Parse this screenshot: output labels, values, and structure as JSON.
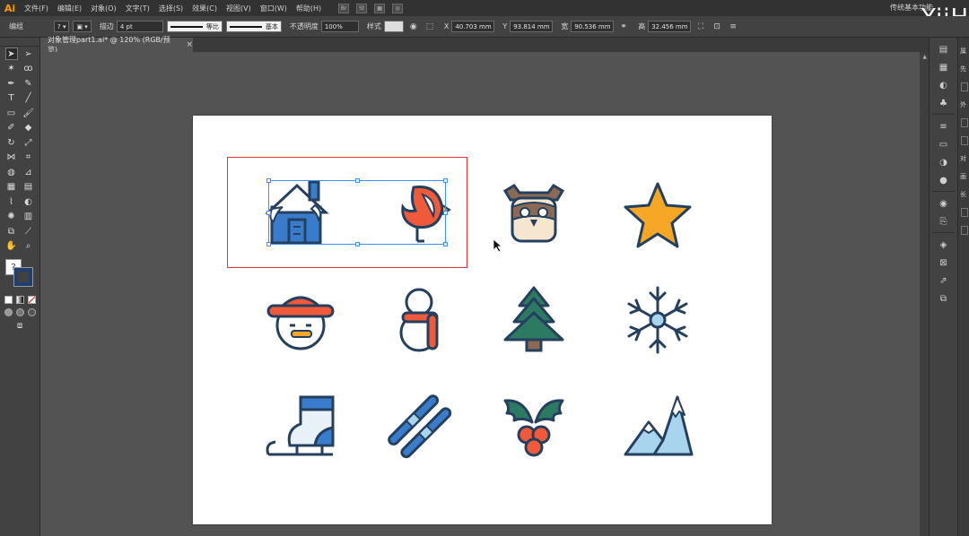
{
  "app": {
    "logo": "Ai",
    "workspace": "传统基本功能",
    "watermark": "YiiH"
  },
  "menu": [
    "文件(F)",
    "编辑(E)",
    "对象(O)",
    "文字(T)",
    "选择(S)",
    "效果(C)",
    "视图(V)",
    "窗口(W)",
    "帮助(H)"
  ],
  "menu_icons": {
    "bridge": "Br",
    "stock": "St"
  },
  "controlbar": {
    "group_label": "编组",
    "stroke_label": "描边",
    "stroke_weight": "4 pt",
    "stroke_profile": "等比",
    "brush_style": "基本",
    "opacity_label": "不透明度",
    "opacity_value": "100%",
    "style_label": "样式",
    "x_label": "X",
    "x_value": "40.703 mm",
    "y_label": "Y",
    "y_value": "93.814 mm",
    "w_label": "宽",
    "w_value": "90.536 mm",
    "h_label": "高",
    "h_value": "32.456 mm"
  },
  "document": {
    "tab_title": "对象管理part1.ai* @ 120% (RGB/预览)",
    "close": "×"
  },
  "toolbar": {
    "fill_glyph": "?"
  },
  "right_panel_b": {
    "labels": [
      "属",
      "先",
      "外",
      "对",
      "画",
      "长"
    ]
  },
  "icons": [
    "house-icon",
    "bird-icon",
    "owl-icon",
    "star-icon",
    "snowman-hat-icon",
    "snowman-scarf-icon",
    "pine-tree-icon",
    "snowflake-icon",
    "ice-skate-icon",
    "skis-icon",
    "holly-icon",
    "mountain-icon"
  ],
  "colors": {
    "navy": "#24405e",
    "blue": "#3a7ccc",
    "light_blue": "#a8d4ee",
    "orange_red": "#f05a3a",
    "orange": "#f7a726",
    "green": "#2c7a62",
    "brown": "#8b6a55",
    "cream": "#f6e6cf",
    "selection_red": "#e2353d",
    "selection_blue": "#3d8eff"
  }
}
